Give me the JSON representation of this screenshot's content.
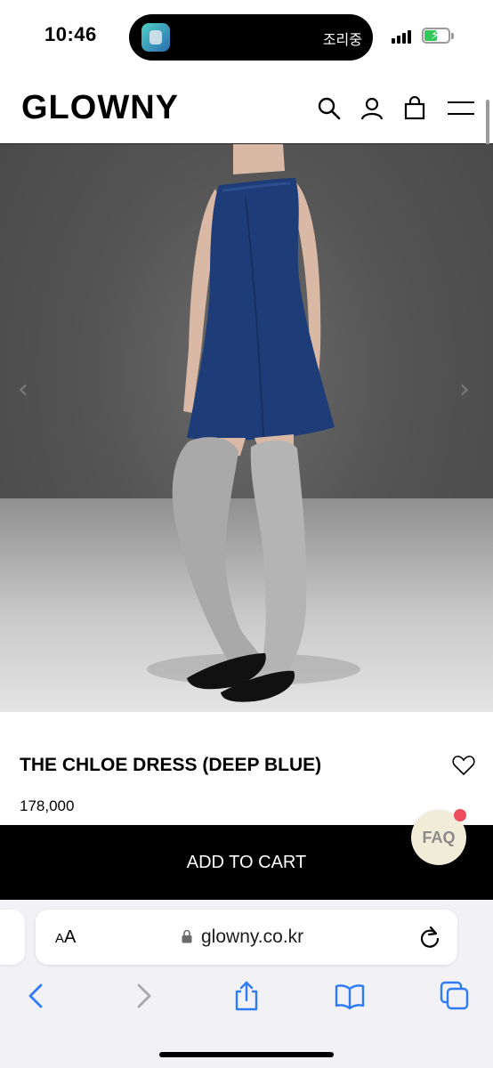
{
  "status_bar": {
    "time": "10:46",
    "live_activity_text": "조리중"
  },
  "header": {
    "logo": "GLOWNY"
  },
  "product": {
    "title": "THE CHLOE DRESS (DEEP BLUE)",
    "price": "178,000"
  },
  "cart": {
    "button_label": "ADD TO CART"
  },
  "faq": {
    "label": "FAQ"
  },
  "browser": {
    "text_size_label_small": "A",
    "text_size_label_large": "A",
    "url": "glowny.co.kr"
  },
  "colors": {
    "accent_green": "#34c759",
    "ios_blue": "#2f7bf6",
    "faq_bg": "#f1ecd8",
    "badge_red": "#ee4e5e"
  }
}
